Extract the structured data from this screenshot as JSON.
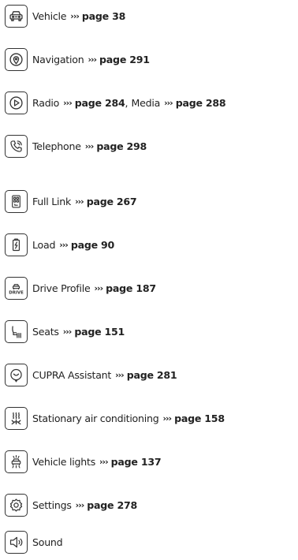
{
  "entries": [
    {
      "icon": "car-icon",
      "label": "Vehicle",
      "arrow": "›››",
      "page": "page 38"
    },
    {
      "icon": "location-pin-icon",
      "label": "Navigation",
      "arrow": "›››",
      "page": "page 291"
    },
    {
      "icon": "play-icon",
      "label": "Radio",
      "arrow": "›››",
      "page": "page 284",
      "sep": ",",
      "label2": "Media",
      "arrow2": "›››",
      "page2": "page 288"
    },
    {
      "icon": "phone-icon",
      "label": "Telephone",
      "arrow": "›››",
      "page": "page 298"
    },
    {
      "icon": "full-link-icon",
      "label": "Full Link",
      "arrow": "›››",
      "page": "page 267"
    },
    {
      "icon": "battery-charge-icon",
      "label": "Load",
      "arrow": "›››",
      "page": "page 90"
    },
    {
      "icon": "drive-profile-icon",
      "icon_text": "DRIVE",
      "label": "Drive Profile",
      "arrow": "›››",
      "page": "page 187"
    },
    {
      "icon": "seat-heating-icon",
      "label": "Seats",
      "arrow": "›››",
      "page": "page 151"
    },
    {
      "icon": "assistant-icon",
      "label": "CUPRA Assistant",
      "arrow": "›››",
      "page": "page 281"
    },
    {
      "icon": "stationary-air-conditioning-icon",
      "label": "Stationary air conditioning",
      "arrow": "›››",
      "page": "page 158"
    },
    {
      "icon": "vehicle-lights-icon",
      "label": "Vehicle lights",
      "arrow": "›››",
      "page": "page 137"
    },
    {
      "icon": "settings-gear-icon",
      "label": "Settings",
      "arrow": "›››",
      "page": "page 278"
    },
    {
      "icon": "speaker-icon",
      "label": "Sound"
    }
  ],
  "colors": {
    "text": "#222222",
    "icon_stroke": "#333333",
    "background": "#ffffff"
  }
}
